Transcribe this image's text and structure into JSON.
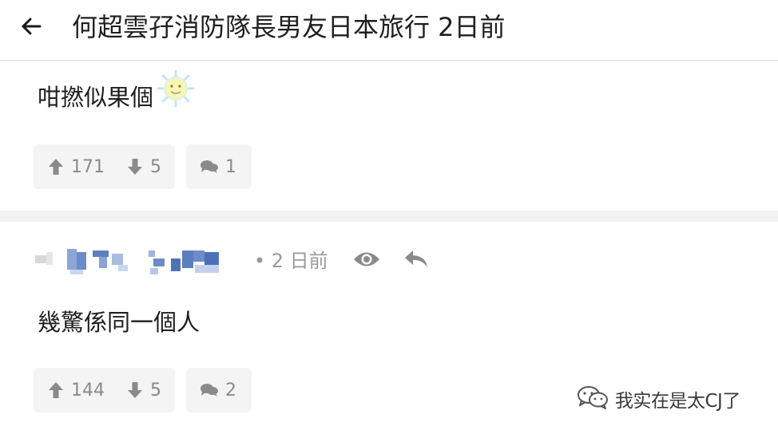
{
  "header": {
    "back_icon": "arrow-left-icon",
    "title": "何超雲孖消防隊長男友日本旅行 2日前"
  },
  "comment1": {
    "text": "咁撚似果個",
    "emoji_icon": "sun-face-emoji-icon",
    "upvotes": "171",
    "downvotes": "5",
    "replies": "1"
  },
  "comment2": {
    "time": "• 2 日前",
    "view_icon": "eye-icon",
    "reply_icon": "reply-arrow-icon",
    "text": "幾驚係同一個人",
    "upvotes": "144",
    "downvotes": "5",
    "replies": "2"
  },
  "watermark": {
    "icon": "wechat-icon",
    "text": "我实在是太CJ了"
  },
  "colors": {
    "icon_gray": "#8a8a8a",
    "chip_bg": "#f4f4f4",
    "divider": "#f2f2f2"
  }
}
